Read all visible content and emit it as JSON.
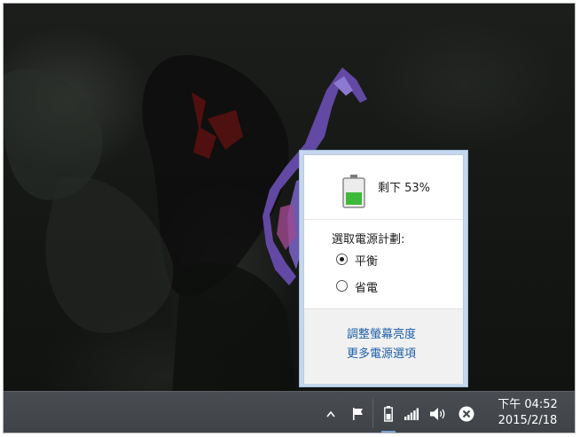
{
  "flyout": {
    "battery": {
      "remaining_text": "剩下 53%",
      "percent": 53
    },
    "plan_label": "選取電源計劃:",
    "plans": [
      {
        "label": "平衡",
        "selected": true
      },
      {
        "label": "省電",
        "selected": false
      }
    ],
    "links": {
      "brightness": "調整螢幕亮度",
      "more_options": "更多電源選項"
    }
  },
  "taskbar": {
    "time": "下午 04:52",
    "date": "2015/2/18",
    "tray_icons": [
      "chevron-up-icon",
      "action-center-flag-icon",
      "battery-icon",
      "network-signal-icon",
      "volume-icon",
      "close-circle-icon"
    ]
  },
  "colors": {
    "battery_fill": "#3fb93a",
    "link": "#1f5fa8",
    "taskbar": "#44484c"
  }
}
